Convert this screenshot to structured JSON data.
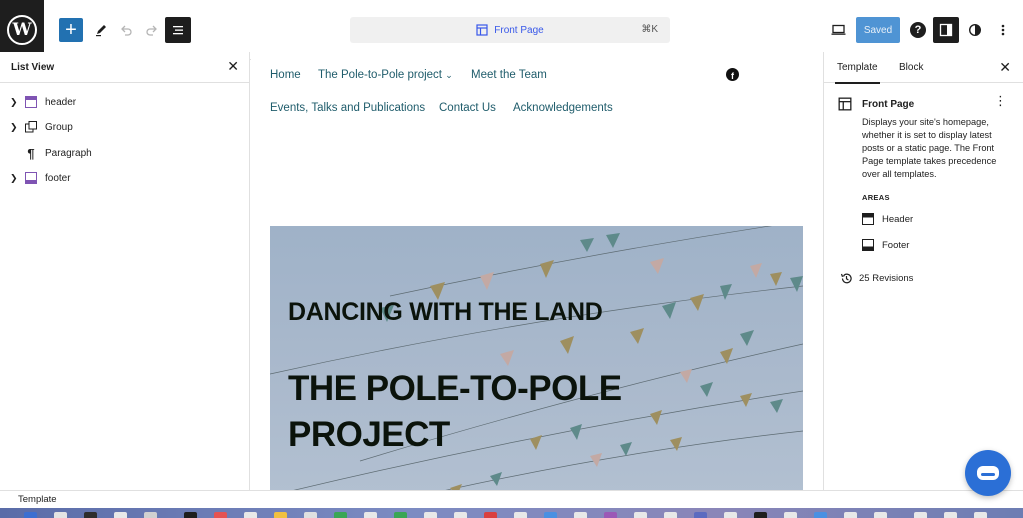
{
  "toolbar": {
    "doc_title": "Front Page",
    "doc_shortcut": "⌘K",
    "saved_label": "Saved",
    "accent_color": "#2271b1"
  },
  "list_view": {
    "title": "List View",
    "items": [
      {
        "label": "header",
        "icon": "template-part-icon",
        "expandable": true
      },
      {
        "label": "Group",
        "icon": "group-icon",
        "expandable": true
      },
      {
        "label": "Paragraph",
        "icon": "paragraph-icon",
        "expandable": false
      },
      {
        "label": "footer",
        "icon": "template-part-icon",
        "expandable": true
      }
    ]
  },
  "canvas": {
    "nav": {
      "home": "Home",
      "pole_project": "The Pole-to-Pole project",
      "team": "Meet the Team",
      "events": "Events, Talks and Publications",
      "contact": "Contact Us",
      "ack": "Acknowledgements"
    },
    "hero": {
      "subtitle": "DANCING WITH THE LAND",
      "title": "THE POLE-TO-POLE PROJECT"
    }
  },
  "sidebar": {
    "tabs": [
      "Template",
      "Block"
    ],
    "active_tab": "Template",
    "template_name": "Front Page",
    "template_description": "Displays your site's homepage, whether it is set to display latest posts or a static page. The Front Page template takes precedence over all templates.",
    "areas_heading": "AREAS",
    "areas": [
      "Header",
      "Footer"
    ],
    "revisions": "25 Revisions"
  },
  "footer": {
    "breadcrumb": "Template"
  }
}
